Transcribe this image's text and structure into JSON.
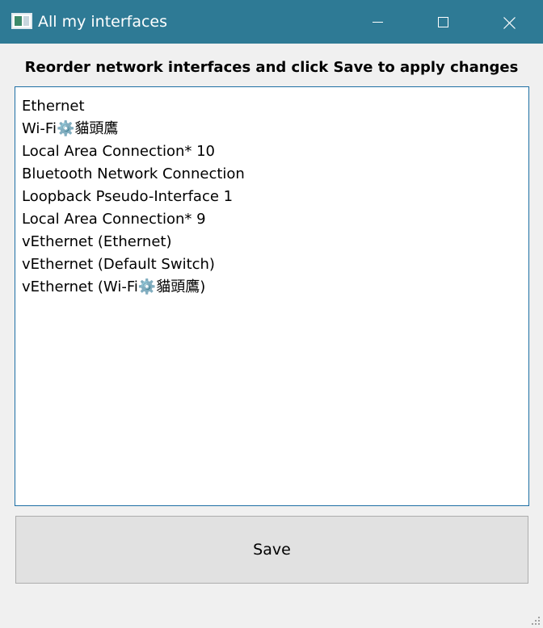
{
  "window": {
    "title": "All my interfaces",
    "title_bar_color": "#2e7a95",
    "controls": [
      "minimize-icon",
      "maximize-icon",
      "close-icon"
    ]
  },
  "heading": "Reorder network interfaces and click Save to apply changes",
  "interfaces": [
    "Ethernet",
    "Wi-Fi⚙️貓頭鷹",
    "Local Area Connection* 10",
    "Bluetooth Network Connection",
    "Loopback Pseudo-Interface 1",
    "Local Area Connection* 9",
    "vEthernet (Ethernet)",
    "vEthernet (Default Switch)",
    "vEthernet (Wi-Fi⚙️貓頭鷹)"
  ],
  "save_label": "Save"
}
